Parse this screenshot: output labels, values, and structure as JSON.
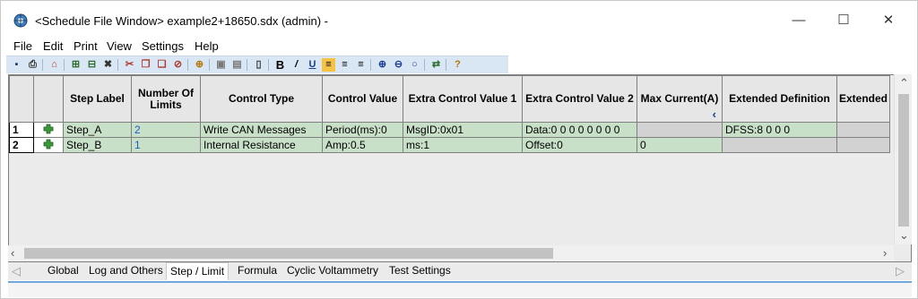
{
  "window": {
    "title": "<Schedule File Window> example2+18650.sdx (admin) -",
    "minimize_glyph": "—",
    "maximize_glyph": "☐",
    "close_glyph": "✕"
  },
  "menu": {
    "items": [
      "File",
      "Edit",
      "Print",
      "View",
      "Settings",
      "Help"
    ]
  },
  "toolbar": {
    "icons": [
      "save-icon",
      "print-icon",
      "home-icon",
      "insert-step-icon",
      "append-step-icon",
      "delete-step-icon",
      "cut-icon",
      "copy-icon",
      "paste-icon",
      "clear-icon",
      "import-icon",
      "copy-cells-icon",
      "paste-cells-icon",
      "clipboard-icon",
      "bold-icon",
      "italic-icon",
      "underline-icon",
      "align-left-icon",
      "align-center-icon",
      "align-right-icon",
      "zoom-in-icon",
      "zoom-out-icon",
      "zoom-search-icon",
      "swap-icon",
      "help-icon"
    ]
  },
  "grid": {
    "headers": [
      "",
      "",
      "Step Label",
      "Number Of Limits",
      "Control Type",
      "Control Value",
      "Extra Control Value 1",
      "Extra Control Value 2",
      "Max Current(A)",
      "Extended Definition",
      "Extended"
    ],
    "rows": [
      {
        "num": "1",
        "label": "Step_A",
        "limits": "2",
        "control_type": "Write CAN Messages",
        "control_value": "Period(ms):0",
        "extra1": "MsgID:0x01",
        "extra2": "Data:0 0 0 0 0 0 0 0",
        "max_current": "",
        "ext_def": "DFSS:8 0 0 0",
        "extended": ""
      },
      {
        "num": "2",
        "label": "Step_B",
        "limits": "1",
        "control_type": "Internal Resistance",
        "control_value": "Amp:0.5",
        "extra1": "ms:1",
        "extra2": "Offset:0",
        "max_current": "0",
        "ext_def": "",
        "extended": ""
      }
    ],
    "sort_indicator": "‹"
  },
  "tabs": [
    "Global",
    "Log and Others",
    "Step / Limit",
    "Formula",
    "Cyclic Voltammetry",
    "Test Settings"
  ],
  "active_tab": "Step / Limit",
  "colors": {
    "row_fill": "#c8e0c8",
    "toolbar_bg": "#d9e6f4",
    "accent": "#6fa8dc"
  }
}
